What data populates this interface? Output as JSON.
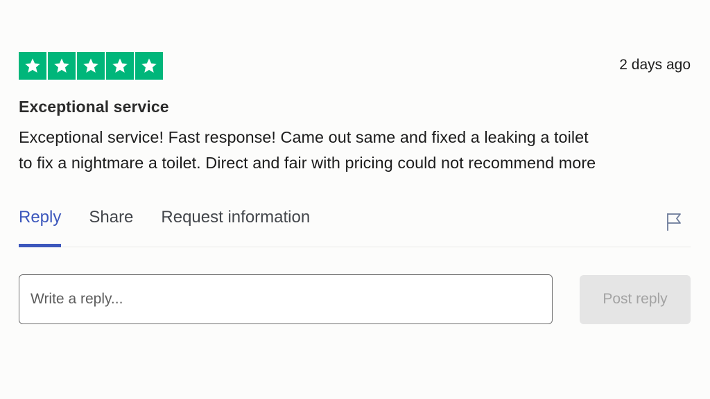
{
  "review": {
    "rating": 5,
    "rating_max": 5,
    "star_color": "#00b67a",
    "date": "2 days ago",
    "title": "Exceptional service",
    "body_line_1": "Exceptional service! Fast response! Came out same and fixed a leaking a toilet",
    "body_line_2": "to fix a nightmare a toilet. Direct and fair with pricing could not recommend more"
  },
  "tabs": {
    "reply": "Reply",
    "share": "Share",
    "request_info": "Request information",
    "active": "reply",
    "active_color": "#3c57bc",
    "flag_icon": "flag-icon"
  },
  "reply_form": {
    "placeholder": "Write a reply...",
    "value": "",
    "post_label": "Post reply",
    "post_enabled": false
  }
}
